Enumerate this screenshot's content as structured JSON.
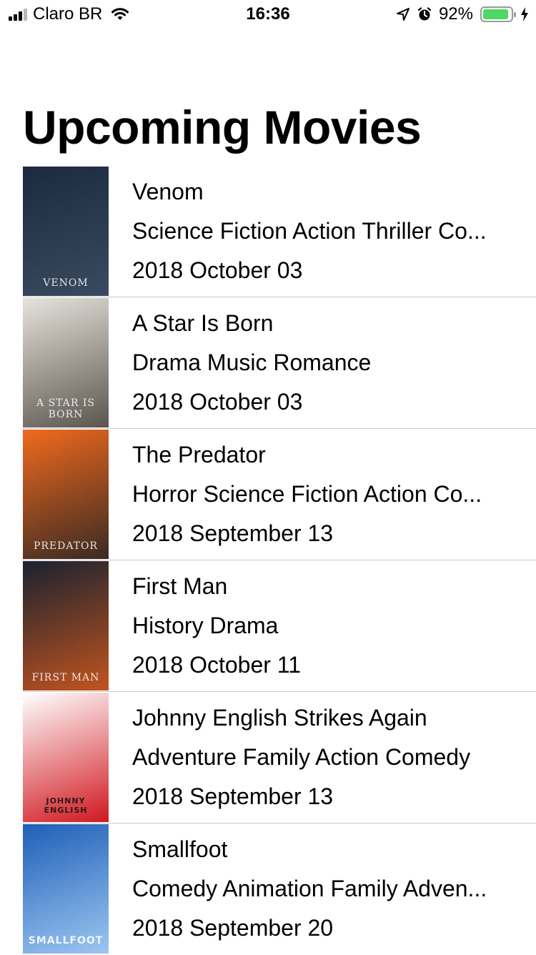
{
  "status_bar": {
    "carrier": "Claro BR",
    "time": "16:36",
    "battery_percent": "92%",
    "battery_level": 0.92,
    "battery_color": "#4cd964",
    "icons": [
      "signal-icon",
      "wifi-icon",
      "location-icon",
      "alarm-icon",
      "battery-icon",
      "charging-bolt-icon"
    ]
  },
  "page": {
    "title": "Upcoming Movies"
  },
  "movies": [
    {
      "title": "Venom",
      "genres": "Science Fiction Action Thriller Co...",
      "date": "2018 October 03",
      "poster_text": "VENOM",
      "poster_colors": [
        "#1b2a3e",
        "#3a4a60"
      ]
    },
    {
      "title": "A Star Is Born",
      "genres": "Drama Music Romance",
      "date": "2018 October 03",
      "poster_text": "A STAR IS BORN",
      "poster_colors": [
        "#e6e3dc",
        "#5a554d"
      ]
    },
    {
      "title": "The Predator",
      "genres": "Horror Science Fiction Action Co...",
      "date": "2018 September 13",
      "poster_text": "PREDATOR",
      "poster_colors": [
        "#f06a1e",
        "#3a2a22"
      ]
    },
    {
      "title": "First Man",
      "genres": "History Drama",
      "date": "2018 October 11",
      "poster_text": "FIRST MAN",
      "poster_colors": [
        "#1a2230",
        "#c2541f"
      ]
    },
    {
      "title": "Johnny English Strikes Again",
      "genres": "Adventure Family Action Comedy",
      "date": "2018 September 13",
      "poster_text": "JOHNNY ENGLISH",
      "poster_colors": [
        "#ffffff",
        "#d0181f"
      ]
    },
    {
      "title": "Smallfoot",
      "genres": "Comedy Animation Family Adven...",
      "date": "2018 September 20",
      "poster_text": "SMALLFOOT",
      "poster_colors": [
        "#1f5fb8",
        "#9cc6f0"
      ]
    }
  ]
}
